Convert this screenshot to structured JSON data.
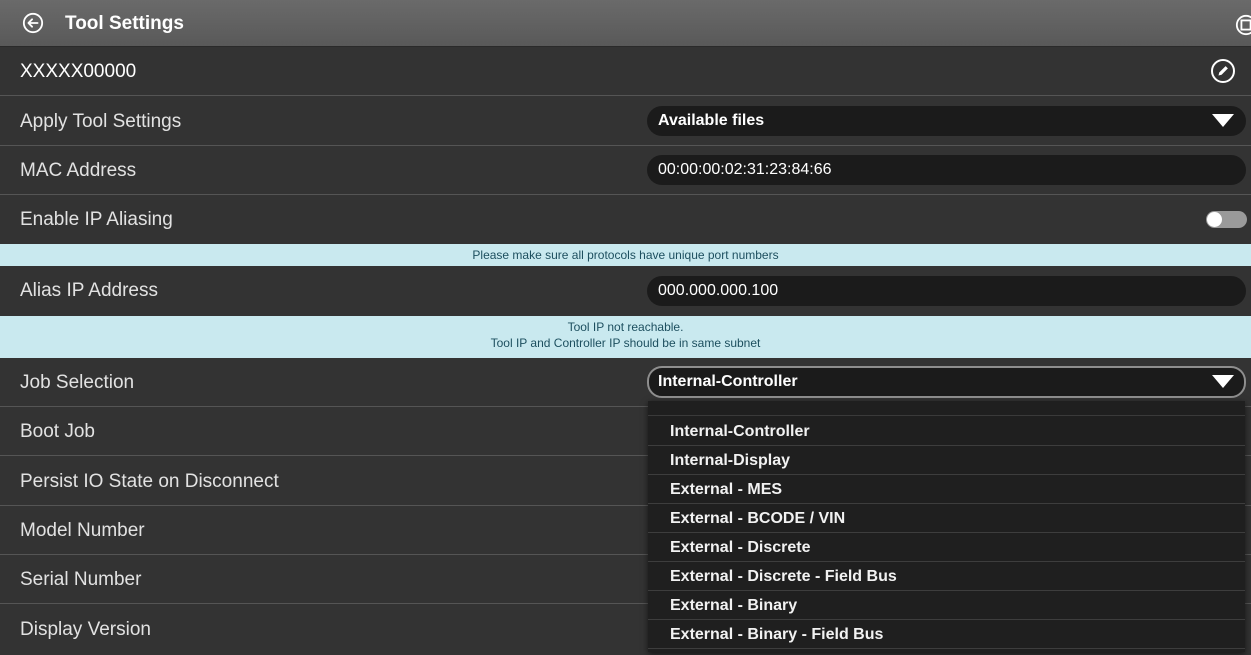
{
  "header": {
    "title": "Tool Settings",
    "back_icon": "circle-arrow-left-icon",
    "corner_icon": "exit-icon"
  },
  "tool_name": {
    "value": "XXXXX00000",
    "edit_icon": "pencil-circle-icon"
  },
  "rows": {
    "apply": {
      "label": "Apply Tool Settings",
      "value": "Available files"
    },
    "mac": {
      "label": "MAC Address",
      "value": "00:00:00:02:31:23:84:66"
    },
    "aliasing": {
      "label": "Enable IP Aliasing",
      "enabled": false
    },
    "alias_ip": {
      "label": "Alias IP Address",
      "value": "000.000.000.100"
    },
    "job": {
      "label": "Job Selection",
      "value": "Internal-Controller"
    },
    "boot_job": {
      "label": "Boot Job"
    },
    "persist": {
      "label": "Persist IO State on Disconnect"
    },
    "model": {
      "label": "Model Number"
    },
    "serial": {
      "label": "Serial Number"
    },
    "display": {
      "label": "Display Version"
    }
  },
  "banners": {
    "ports": "Please make sure all protocols have unique port numbers",
    "reach_line1": "Tool IP not reachable.",
    "reach_line2": "Tool IP and Controller IP should be in same subnet"
  },
  "job_options": [
    "Internal-Controller",
    "Internal-Display",
    "External - MES",
    "External - BCODE / VIN",
    "External - Discrete",
    "External - Discrete - Field Bus",
    "External - Binary",
    "External - Binary - Field Bus"
  ],
  "colors": {
    "background": "#333333",
    "titlebar": "#606060",
    "field": "#1b1b1b",
    "banner": "#c9e9ef",
    "banner_text": "#1d4f5f"
  }
}
